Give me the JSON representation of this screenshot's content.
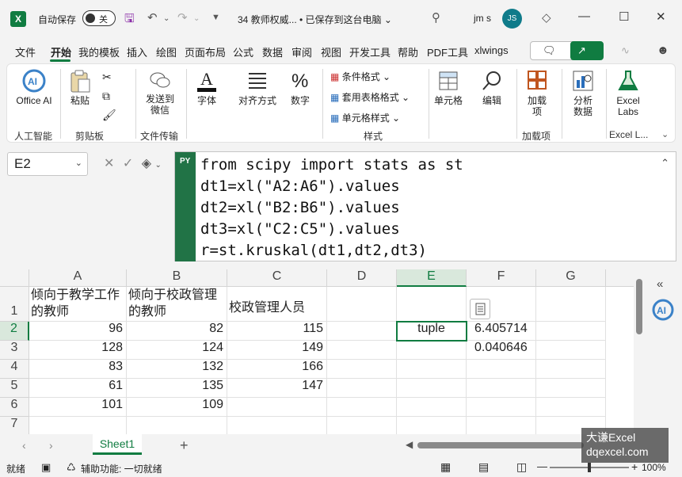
{
  "titlebar": {
    "autosave_label": "自动保存",
    "autosave_state": "关",
    "doc_title": "34 教师权威... • 已保存到这台电脑 ⌄",
    "user_name": "jm s",
    "user_initials": "JS"
  },
  "tabs": [
    "文件",
    "开始",
    "我的模板",
    "插入",
    "绘图",
    "页面布局",
    "公式",
    "数据",
    "审阅",
    "视图",
    "开发工具",
    "帮助",
    "PDF工具",
    "xlwings"
  ],
  "active_tab": "开始",
  "ribbon": {
    "office_ai": "Office AI",
    "ai_group": "人工智能",
    "paste": "粘贴",
    "clipboard_group": "剪贴板",
    "send_wechat": "发送到微信",
    "file_transfer_group": "文件传输",
    "font": "字体",
    "align": "对齐方式",
    "number": "数字",
    "cond_format": "条件格式",
    "table_format": "套用表格格式",
    "cell_style": "单元格样式",
    "style_group": "样式",
    "cells": "单元格",
    "edit": "编辑",
    "addins": "加载项",
    "addins_group": "加载项",
    "analyze": "分析数据",
    "excel_labs": "Excel Labs",
    "excel_labs_group": "Excel L..."
  },
  "name_box": "E2",
  "formula": {
    "badge": "PY",
    "lines": [
      "from scipy import stats as st",
      "dt1=xl(\"A2:A6\").values",
      "dt2=xl(\"B2:B6\").values",
      "dt3=xl(\"C2:C5\").values",
      "r=st.kruskal(dt1,dt2,dt3)"
    ]
  },
  "grid": {
    "columns": [
      "A",
      "B",
      "C",
      "D",
      "E",
      "F",
      "G"
    ],
    "rows": [
      "1",
      "2",
      "3",
      "4",
      "5",
      "6",
      "7"
    ],
    "header_row": [
      "倾向于教学工作的教师",
      "倾向于校政管理的教师",
      "校政管理人员"
    ],
    "data": [
      [
        "96",
        "82",
        "115"
      ],
      [
        "128",
        "124",
        "149"
      ],
      [
        "83",
        "132",
        "166"
      ],
      [
        "61",
        "135",
        "147"
      ],
      [
        "101",
        "109",
        ""
      ]
    ],
    "e2": "tuple",
    "f2": "6.405714",
    "f3": "0.040646"
  },
  "sheet_tab": "Sheet1",
  "status": {
    "ready": "就绪",
    "accessibility": "辅助功能: 一切就绪",
    "zoom": "100%"
  },
  "watermark": {
    "line1": "大谦Excel",
    "line2": "dqexcel.com"
  },
  "colors": {
    "accent": "#107c41"
  }
}
